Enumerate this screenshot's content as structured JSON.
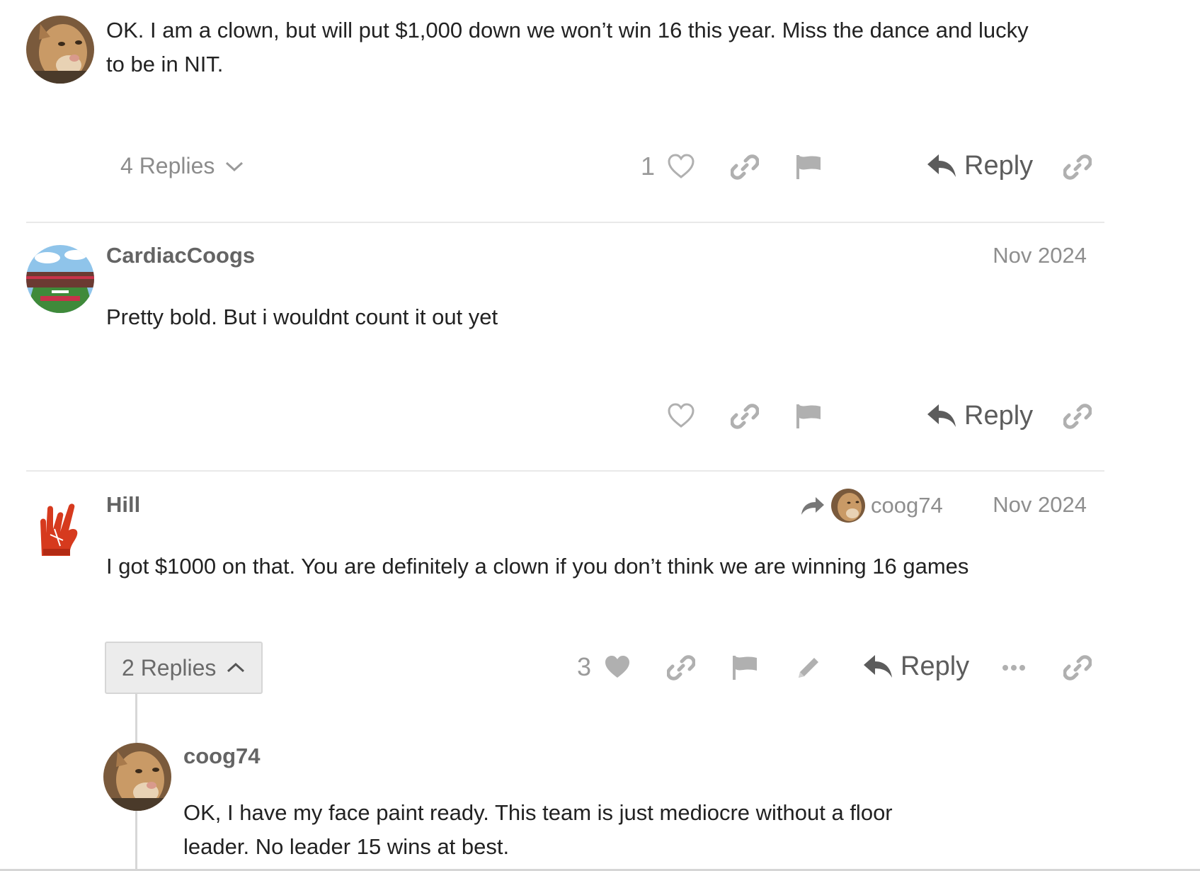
{
  "posts": [
    {
      "username": "",
      "body_lines": [
        "OK. I am a clown, but will put $1,000 down we won’t win 16 this year. Miss the dance and lucky",
        "to be in NIT."
      ],
      "replies_label": "4 Replies",
      "like_count": "1",
      "reply_label": "Reply",
      "avatar_icon": "cougar-avatar-icon"
    },
    {
      "username": "CardiacCoogs",
      "date": "Nov 2024",
      "body_lines": [
        "Pretty bold. But i wouldnt count it out yet"
      ],
      "reply_label": "Reply",
      "avatar_icon": "stadium-avatar-icon"
    },
    {
      "username": "Hill",
      "date": "Nov 2024",
      "reply_to_user": "coog74",
      "body_lines": [
        "I got $1000 on that. You are definitely a clown if you don’t think we are winning 16 games"
      ],
      "replies_label": "2 Replies",
      "like_count": "3",
      "reply_label": "Reply",
      "avatar_icon": "foam-finger-avatar-icon"
    }
  ],
  "nested_reply": {
    "username": "coog74",
    "body_lines": [
      "OK, I have my face paint ready. This team is just mediocre without a floor",
      "leader. No leader 15 wins at best."
    ],
    "avatar_icon": "cougar-avatar-icon"
  },
  "colors": {
    "text": "#222222",
    "muted": "#8e8e8e",
    "icon": "#b0b0b0",
    "divider": "#e9e9e9",
    "replies_open_bg": "#ececec"
  }
}
